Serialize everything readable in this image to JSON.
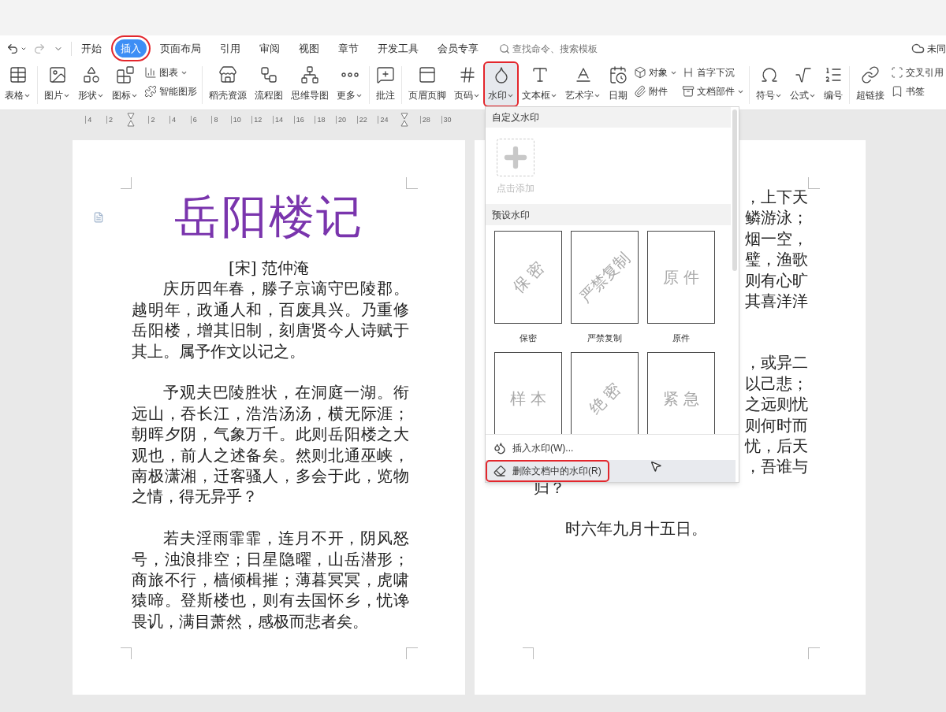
{
  "tabs": [
    {
      "label": "开始",
      "selected": false,
      "highlighted": false
    },
    {
      "label": "插入",
      "selected": true,
      "highlighted": true
    },
    {
      "label": "页面布局",
      "selected": false,
      "highlighted": false
    },
    {
      "label": "引用",
      "selected": false,
      "highlighted": false
    },
    {
      "label": "审阅",
      "selected": false,
      "highlighted": false
    },
    {
      "label": "视图",
      "selected": false,
      "highlighted": false
    },
    {
      "label": "章节",
      "selected": false,
      "highlighted": false
    },
    {
      "label": "开发工具",
      "selected": false,
      "highlighted": false
    },
    {
      "label": "会员专享",
      "selected": false,
      "highlighted": false
    }
  ],
  "search": {
    "placeholder": "查找命令、搜索模板"
  },
  "sync_status": "未同",
  "ribbon": {
    "groups": [
      {
        "items": [
          {
            "kind": "large",
            "label": "表格",
            "has_menu": true,
            "pressed": false
          }
        ]
      },
      {
        "items": [
          {
            "kind": "large",
            "label": "图片",
            "has_menu": true,
            "pressed": false
          },
          {
            "kind": "large",
            "label": "形状",
            "has_menu": true,
            "pressed": false
          },
          {
            "kind": "large",
            "label": "图标",
            "has_menu": true,
            "pressed": false
          },
          {
            "kind": "stack",
            "entries": [
              {
                "label": "图表",
                "has_menu": true
              },
              {
                "label": "智能图形",
                "has_menu": false
              }
            ]
          }
        ]
      },
      {
        "items": [
          {
            "kind": "large",
            "label": "稻壳资源",
            "has_menu": false,
            "pressed": false
          },
          {
            "kind": "large",
            "label": "流程图",
            "has_menu": false,
            "pressed": false
          },
          {
            "kind": "large",
            "label": "思维导图",
            "has_menu": false,
            "pressed": false
          },
          {
            "kind": "large",
            "label": "更多",
            "has_menu": true,
            "pressed": false
          }
        ]
      },
      {
        "items": [
          {
            "kind": "large",
            "label": "批注",
            "has_menu": false,
            "pressed": false
          }
        ]
      },
      {
        "items": [
          {
            "kind": "large",
            "label": "页眉页脚",
            "has_menu": false,
            "pressed": false
          },
          {
            "kind": "large",
            "label": "页码",
            "has_menu": true,
            "pressed": false
          },
          {
            "kind": "large",
            "label": "水印",
            "has_menu": true,
            "pressed": true
          },
          {
            "kind": "large",
            "label": "文本框",
            "has_menu": true,
            "pressed": false
          },
          {
            "kind": "large",
            "label": "艺术字",
            "has_menu": true,
            "pressed": false
          },
          {
            "kind": "large",
            "label": "日期",
            "has_menu": false,
            "pressed": false
          },
          {
            "kind": "stack",
            "entries": [
              {
                "label": "对象",
                "has_menu": true
              },
              {
                "label": "附件",
                "has_menu": false
              }
            ]
          },
          {
            "kind": "stack",
            "entries": [
              {
                "label": "首字下沉",
                "has_menu": false
              },
              {
                "label": "文档部件",
                "has_menu": true
              }
            ]
          }
        ]
      },
      {
        "items": [
          {
            "kind": "large",
            "label": "符号",
            "has_menu": true,
            "pressed": false
          },
          {
            "kind": "large",
            "label": "公式",
            "has_menu": true,
            "pressed": false
          },
          {
            "kind": "large",
            "label": "编号",
            "has_menu": false,
            "pressed": false
          }
        ]
      },
      {
        "items": [
          {
            "kind": "large",
            "label": "超链接",
            "has_menu": false,
            "pressed": false
          },
          {
            "kind": "stack",
            "entries": [
              {
                "label": "交叉引用",
                "has_menu": false
              },
              {
                "label": "书签",
                "has_menu": false
              }
            ]
          }
        ]
      }
    ]
  },
  "ruler": [
    {
      "kind": "number",
      "label": "4"
    },
    {
      "kind": "number",
      "label": "2"
    },
    {
      "kind": "marker"
    },
    {
      "kind": "number",
      "label": "2"
    },
    {
      "kind": "number",
      "label": "4"
    },
    {
      "kind": "number",
      "label": "6"
    },
    {
      "kind": "number",
      "label": "8"
    },
    {
      "kind": "number",
      "label": "10"
    },
    {
      "kind": "number",
      "label": "12"
    },
    {
      "kind": "number",
      "label": "14"
    },
    {
      "kind": "number",
      "label": "16"
    },
    {
      "kind": "number",
      "label": "18"
    },
    {
      "kind": "number",
      "label": "20"
    },
    {
      "kind": "number",
      "label": "22"
    },
    {
      "kind": "number",
      "label": "24"
    },
    {
      "kind": "marker"
    },
    {
      "kind": "number",
      "label": "28"
    },
    {
      "kind": "number",
      "label": "30"
    }
  ],
  "left_page": {
    "title": "岳阳楼记",
    "author": "[宋]  范仲淹",
    "paragraphs": [
      "庆历四年春，滕子京谪守巴陵郡。越明年，政通人和，百废具兴。乃重修岳阳楼，增其旧制，刻唐贤今人诗赋于其上。属予作文以记之。",
      "予观夫巴陵胜状，在洞庭一湖。衔远山，吞长江，浩浩汤汤，横无际涯；朝晖夕阴，气象万千。此则岳阳楼之大观也，前人之述备矣。然则北通巫峡，南极潇湘，迁客骚人，多会于此，览物之情，得无异乎？",
      "若夫淫雨霏霏，连月不开，阴风怒号，浊浪排空；日星隐曜，山岳潜形；商旅不行，樯倾楫摧；薄暮冥冥，虎啸猿啼。登斯楼也，则有去国怀乡，忧谗畏讥，满目萧然，感极而悲者矣。"
    ]
  },
  "right_page": {
    "fragment_groups": [
      [
        "，上下天",
        "鳞游泳；",
        "烟一空，",
        "璧，渔歌",
        "则有心旷",
        "其喜洋洋"
      ],
      [
        "，或异二",
        "以己悲；",
        "之远则忧",
        "则何时而",
        "忧，后天",
        "，吾谁与"
      ]
    ],
    "last_line": "归？",
    "date_line": "时六年九月十五日。"
  },
  "watermark_menu": {
    "custom_header": "自定义水印",
    "add_label": "点击添加",
    "preset_header": "预设水印",
    "presets": [
      {
        "text": "保 密",
        "diagonal": true,
        "label": "保密"
      },
      {
        "text": "严禁复制",
        "diagonal": true,
        "label": "严禁复制"
      },
      {
        "text": "原 件",
        "diagonal": false,
        "label": "原件"
      },
      {
        "text": "样 本",
        "diagonal": false
      },
      {
        "text": "绝 密",
        "diagonal": true
      },
      {
        "text": "紧 急",
        "diagonal": false
      }
    ],
    "actions": [
      {
        "label": "插入水印(W)...",
        "hovered": false,
        "highlighted": false
      },
      {
        "label": "删除文档中的水印(R)",
        "hovered": true,
        "highlighted": true
      }
    ]
  }
}
